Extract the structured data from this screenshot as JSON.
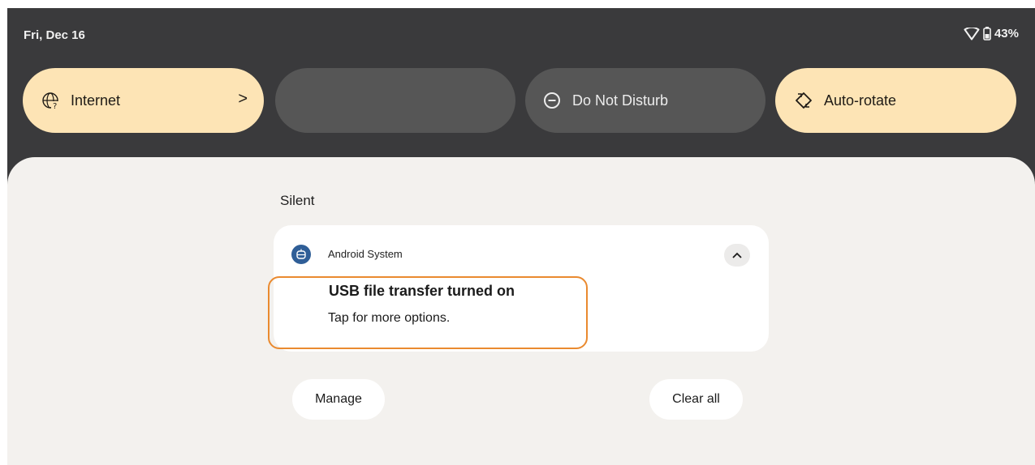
{
  "status_bar": {
    "date": "Fri, Dec 16",
    "battery_text": "43%",
    "battery_level": 0.43,
    "icons": [
      "wifi-icon",
      "battery-icon"
    ]
  },
  "quick_settings": {
    "tiles": [
      {
        "label": "Internet",
        "state": "on",
        "icon": "internet-icon",
        "has_chevron": true,
        "chevron": ">"
      },
      {
        "label": "",
        "state": "off",
        "icon": ""
      },
      {
        "label": "Do Not Disturb",
        "state": "off",
        "icon": "do-not-disturb-icon"
      },
      {
        "label": "Auto-rotate",
        "state": "on",
        "icon": "auto-rotate-icon"
      }
    ]
  },
  "notifications": {
    "section_label": "Silent",
    "items": [
      {
        "app_name": "Android System",
        "app_icon": "android-system-icon",
        "title": "USB file transfer turned on",
        "text": "Tap for more options.",
        "expand_icon": "chevron-up-icon"
      }
    ],
    "manage_label": "Manage",
    "clear_all_label": "Clear all"
  },
  "colors": {
    "shade_background": "#3a3a3c",
    "tile_on": "#fde4b5",
    "tile_off": "#565656",
    "panel_background": "#f3f1ee",
    "highlight": "#ea8a2f",
    "app_icon": "#2f5e97"
  }
}
